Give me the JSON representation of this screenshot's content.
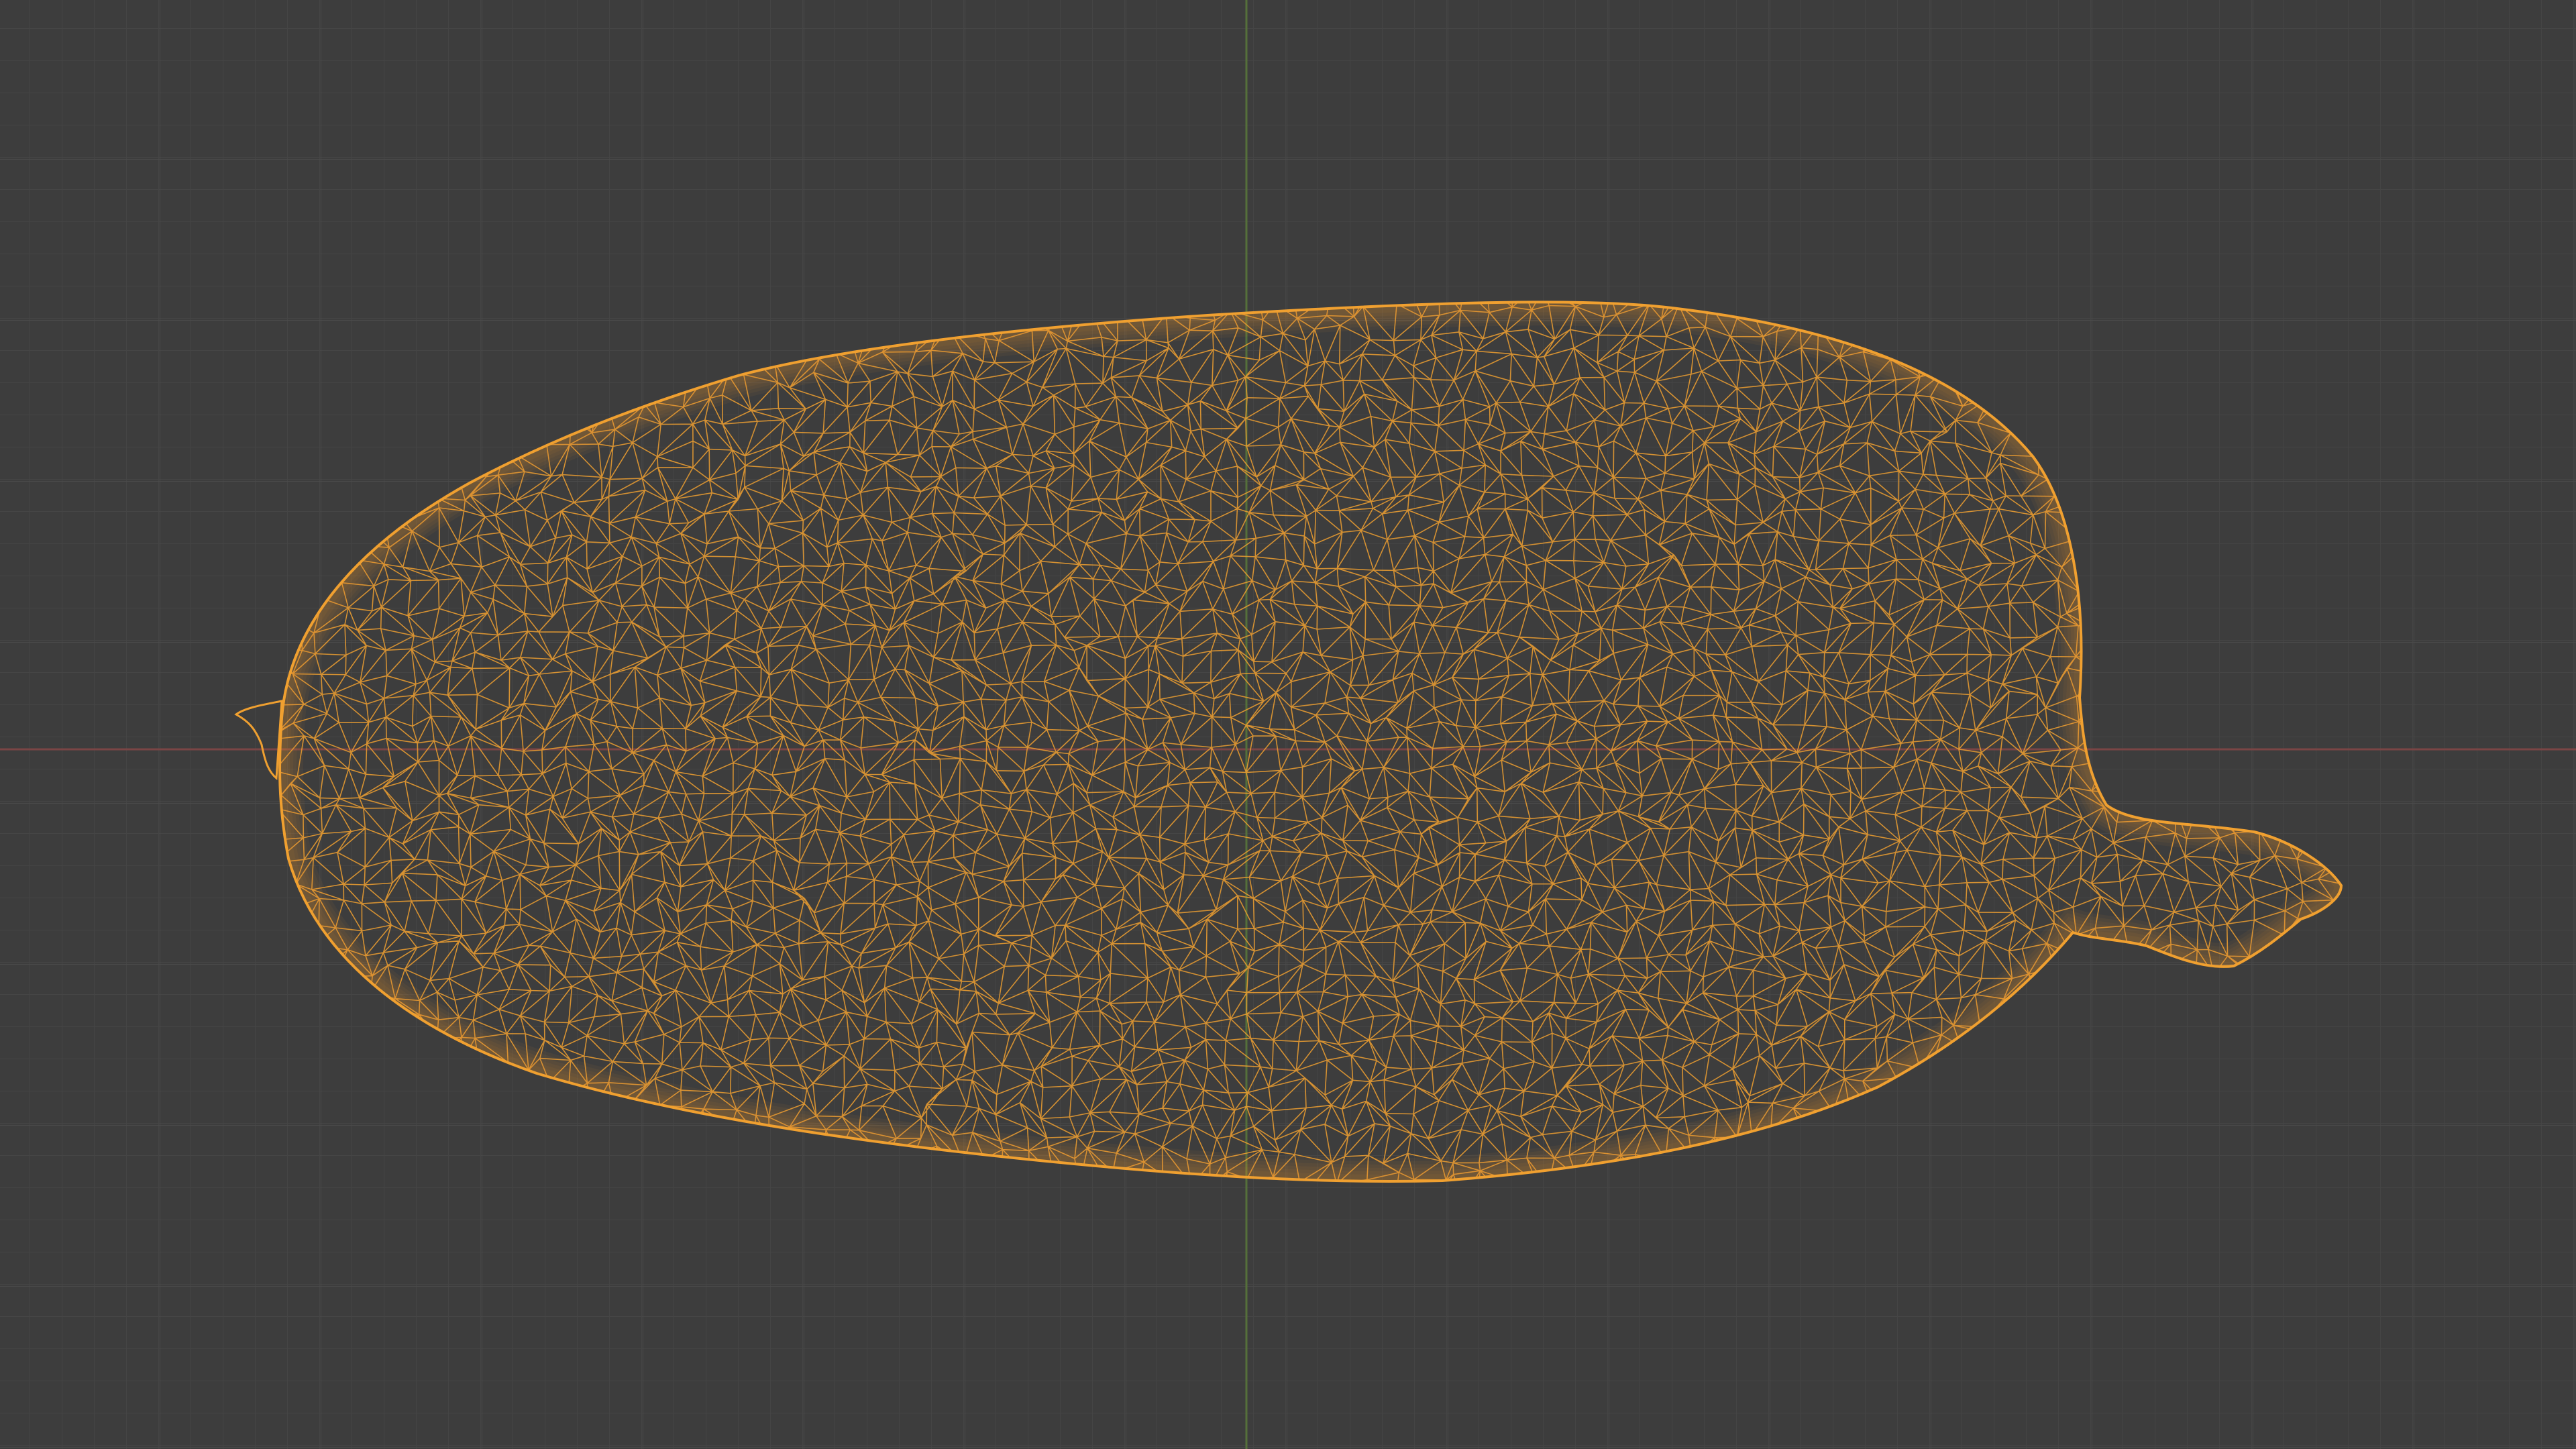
{
  "viewport": {
    "mode": "wireframe",
    "view": "orthographic",
    "background_color": "#3d3d3d",
    "grid_minor_color": "#474747",
    "grid_major_color": "#525252",
    "x_axis_color": "#8a4a4a",
    "y_axis_color": "#5a7a3a",
    "grid_visible": true
  },
  "object": {
    "selected": true,
    "wire_color": "#f0a030",
    "shape": "elongated ellipsoid mesh with stem"
  }
}
